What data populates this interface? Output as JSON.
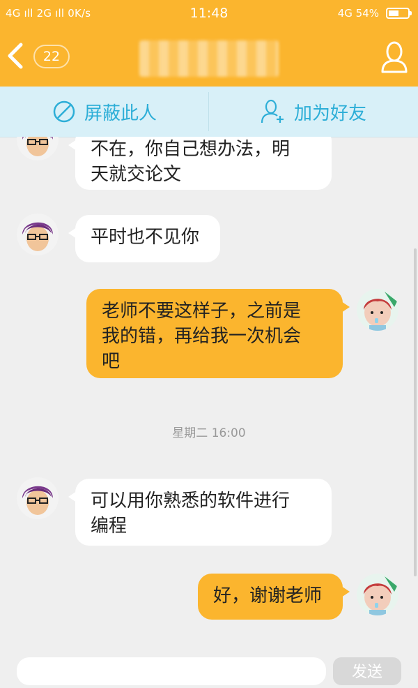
{
  "status_bar": {
    "left": "4G ıll 2G ıll 0K/s",
    "time": "11:48",
    "right": "4G 54%"
  },
  "nav": {
    "back_count": "22"
  },
  "actions": {
    "block_label": "屏蔽此人",
    "add_friend_label": "加为好友"
  },
  "messages": [
    {
      "side": "in",
      "text_line1": "不在，你自己想办法，明",
      "text_line2": "天就交论文"
    },
    {
      "side": "in",
      "text": "平时也不见你"
    },
    {
      "side": "out",
      "text_line1": "老师不要这样子，之前是",
      "text_line2": "我的错，再给我一次机会",
      "text_line3": "吧"
    },
    {
      "side": "in",
      "text_line1": "可以用你熟悉的软件进行",
      "text_line2": "编程"
    },
    {
      "side": "out",
      "text": "好，谢谢老师"
    }
  ],
  "timestamp": "星期二 16:00",
  "input": {
    "send_label": "发送"
  },
  "colors": {
    "brand": "#fbb52e",
    "action_bg": "#d8f0f8",
    "action_text": "#2daed7",
    "chat_bg": "#efefef"
  }
}
